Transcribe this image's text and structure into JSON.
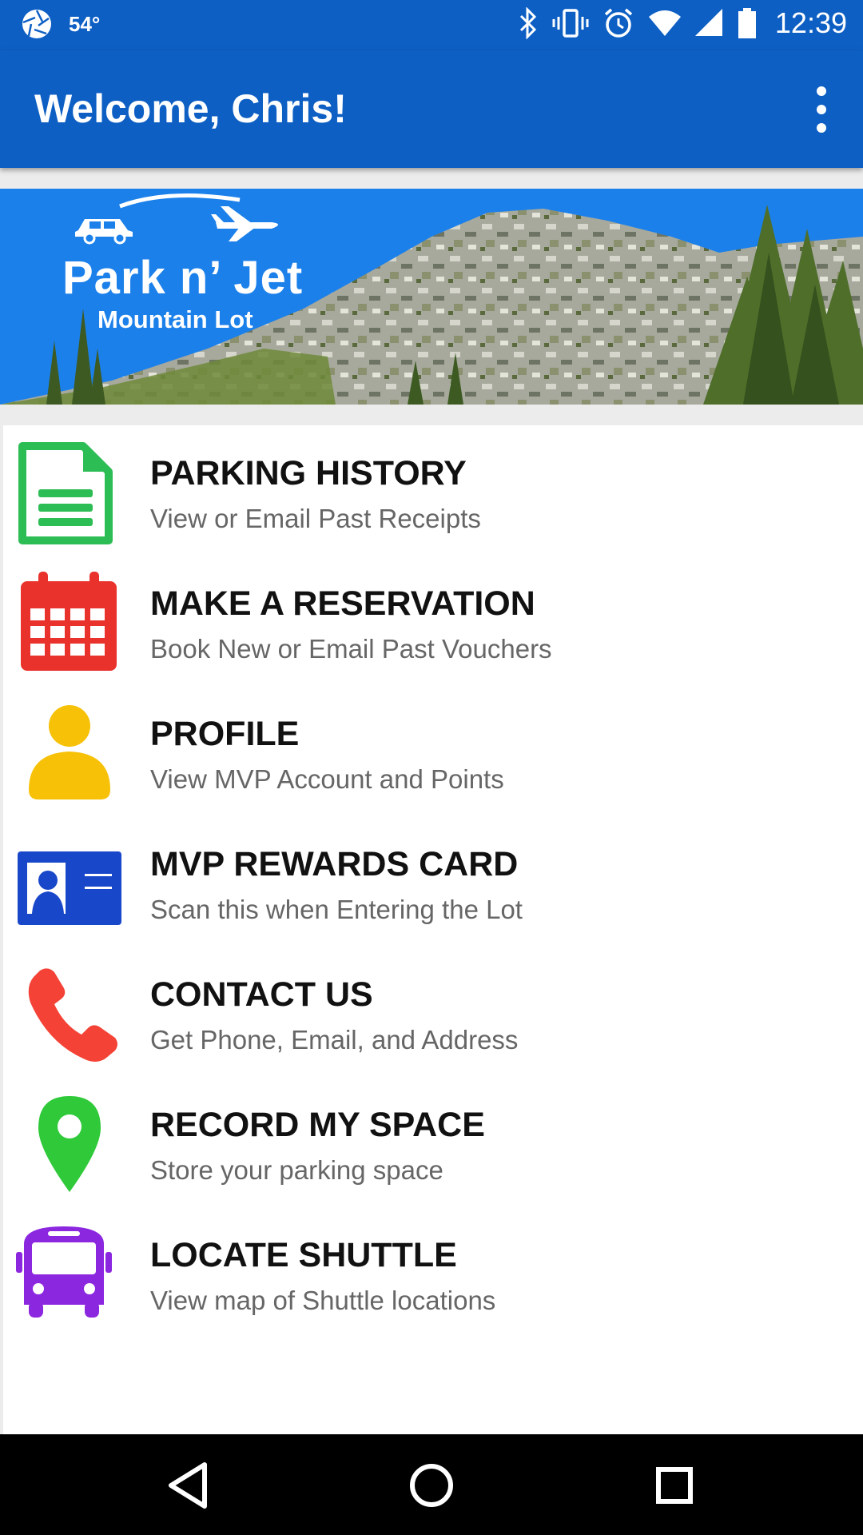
{
  "status_bar": {
    "temperature": "54°",
    "time": "12:39",
    "icons": [
      "camera-aperture-icon",
      "bluetooth-icon",
      "vibrate-icon",
      "alarm-icon",
      "wifi-icon",
      "cell-signal-icon",
      "battery-icon"
    ]
  },
  "app_bar": {
    "title": "Welcome, Chris!",
    "menu_icon": "more-vertical-icon"
  },
  "banner": {
    "logo_title": "Park n’ Jet",
    "logo_subtitle": "Mountain Lot"
  },
  "menu": {
    "items": [
      {
        "title": "PARKING HISTORY",
        "subtitle": "View or Email Past Receipts",
        "icon": "document-icon",
        "color": "#2dbd55"
      },
      {
        "title": "MAKE A RESERVATION",
        "subtitle": "Book New or Email Past Vouchers",
        "icon": "calendar-icon",
        "color": "#e9322c"
      },
      {
        "title": "PROFILE",
        "subtitle": "View MVP Account and Points",
        "icon": "person-icon",
        "color": "#f7c108"
      },
      {
        "title": "MVP REWARDS CARD",
        "subtitle": "Scan this when Entering the Lot",
        "icon": "id-card-icon",
        "color": "#1947c9"
      },
      {
        "title": "CONTACT US",
        "subtitle": "Get Phone, Email, and Address",
        "icon": "phone-icon",
        "color": "#f44336"
      },
      {
        "title": "RECORD MY SPACE",
        "subtitle": "Store your parking space",
        "icon": "map-pin-icon",
        "color": "#2fc93a"
      },
      {
        "title": "LOCATE SHUTTLE",
        "subtitle": "View map of Shuttle locations",
        "icon": "bus-icon",
        "color": "#8c27e0"
      }
    ]
  },
  "nav_bar": {
    "buttons": [
      "back-icon",
      "home-icon",
      "recents-icon"
    ]
  },
  "colors": {
    "primary": "#0d5fc4",
    "banner_sky": "#1c80ea",
    "title_text": "#111111",
    "subtitle_text": "#666666"
  }
}
